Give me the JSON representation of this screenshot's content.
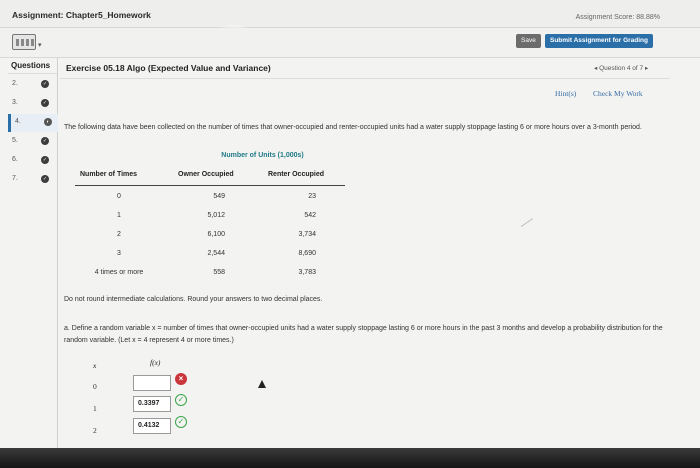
{
  "header": {
    "title": "Assignment: Chapter5_Homework",
    "score": "Assignment Score: 88.88%"
  },
  "toolbar": {
    "calculator_icon": "calculator-icon",
    "save_label": "Save",
    "submit_label": "Submit Assignment for Grading"
  },
  "sidebar": {
    "header": "Questions",
    "items": [
      {
        "num": "2.",
        "status": "complete"
      },
      {
        "num": "3.",
        "status": "complete"
      },
      {
        "num": "4.",
        "status": "partial",
        "current": true
      },
      {
        "num": "5.",
        "status": "complete"
      },
      {
        "num": "6.",
        "status": "complete"
      },
      {
        "num": "7.",
        "status": "complete"
      }
    ]
  },
  "exercise": {
    "title": "Exercise 05.18 Algo (Expected Value and Variance)",
    "nav": "◂  Question 4 of 7  ▸",
    "hint": "Hint(s)",
    "check": "Check My Work",
    "problem": "The following data have been collected on the number of times that owner-occupied and renter-occupied units had a water supply stoppage lasting 6 or more hours over a 3-month period.",
    "table": {
      "group_header": "Number of Units (1,000s)",
      "headers": [
        "Number of Times",
        "Owner Occupied",
        "Renter Occupied"
      ],
      "rows": [
        [
          "0",
          "549",
          "23"
        ],
        [
          "1",
          "5,012",
          "542"
        ],
        [
          "2",
          "6,100",
          "3,734"
        ],
        [
          "3",
          "2,544",
          "8,690"
        ],
        [
          "4 times or more",
          "558",
          "3,783"
        ]
      ]
    },
    "note": "Do not round intermediate calculations. Round your answers to two decimal places.",
    "part_a": "a. Define a random variable x = number of times that owner-occupied units had a water supply stoppage lasting 6 or more hours in the past 3 months and develop a probability distribution for the random variable. (Let x = 4 represent 4 or more times.)",
    "answer_table": {
      "x_header": "x",
      "fx_header": "f(x)",
      "rows": [
        {
          "x": "0",
          "value": "",
          "status": "incorrect"
        },
        {
          "x": "1",
          "value": "0.3397",
          "status": "correct"
        },
        {
          "x": "2",
          "value": "0.4132",
          "status": "correct"
        }
      ]
    }
  }
}
